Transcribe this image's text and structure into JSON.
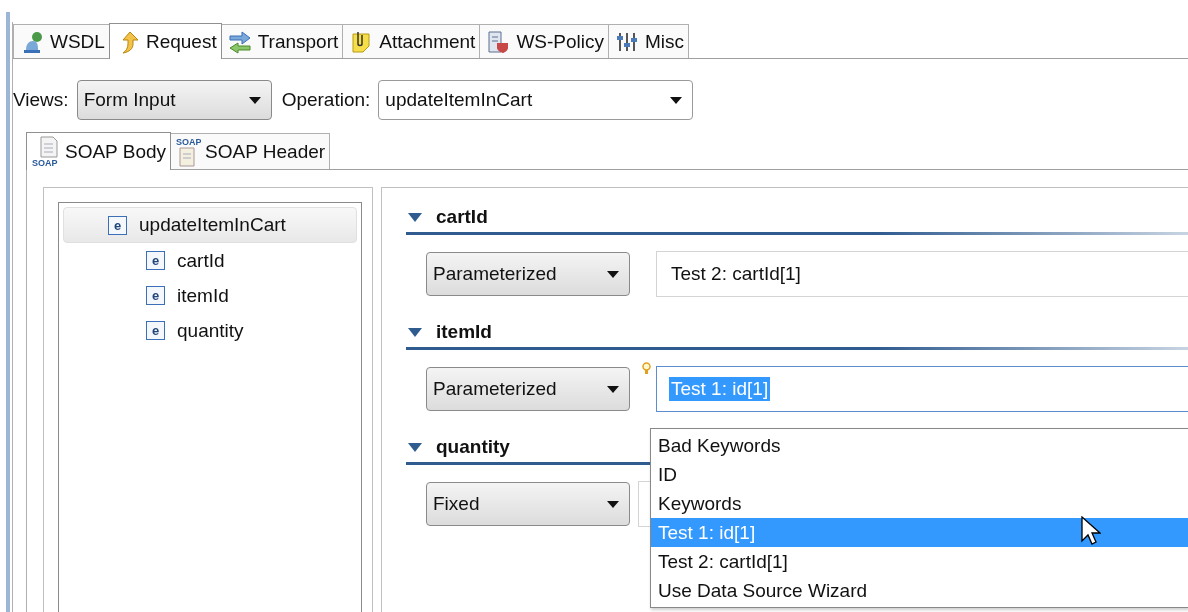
{
  "tabs": [
    {
      "label": "WSDL",
      "selected": false
    },
    {
      "label": "Request",
      "selected": true
    },
    {
      "label": "Transport",
      "selected": false
    },
    {
      "label": "Attachment",
      "selected": false
    },
    {
      "label": "WS-Policy",
      "selected": false
    },
    {
      "label": "Misc",
      "selected": false
    }
  ],
  "toolbar": {
    "views_label": "Views:",
    "views_value": "Form Input",
    "operation_label": "Operation:",
    "operation_value": "updateItemInCart"
  },
  "subtabs": [
    {
      "label": "SOAP Body",
      "icon_text": "SOAP",
      "selected": true
    },
    {
      "label": "SOAP Header",
      "icon_text": "SOAP",
      "selected": false
    }
  ],
  "tree": [
    {
      "label": "updateItemInCart",
      "icon_text": "e",
      "selected": true,
      "children": [
        {
          "label": "cartId",
          "icon_text": "e",
          "selected": false
        },
        {
          "label": "itemId",
          "icon_text": "e",
          "selected": false
        },
        {
          "label": "quantity",
          "icon_text": "e",
          "selected": false
        }
      ]
    }
  ],
  "sections": [
    {
      "title": "cartId",
      "expanded": true,
      "mode": "Parameterized",
      "value": "Test 2: cartId[1]",
      "focused": false
    },
    {
      "title": "itemId",
      "expanded": true,
      "mode": "Parameterized",
      "value": "Test 1: id[1]",
      "focused": true
    },
    {
      "title": "quantity",
      "expanded": true,
      "mode": "Fixed",
      "focused": false
    }
  ],
  "popup": {
    "items": [
      {
        "label": "Bad Keywords",
        "selected": false
      },
      {
        "label": "ID",
        "selected": false
      },
      {
        "label": "Keywords",
        "selected": false
      },
      {
        "label": "Test 1: id[1]",
        "selected": true
      },
      {
        "label": "Test 2: cartId[1]",
        "selected": false
      },
      {
        "label": "Use Data Source Wizard",
        "selected": false
      }
    ]
  }
}
